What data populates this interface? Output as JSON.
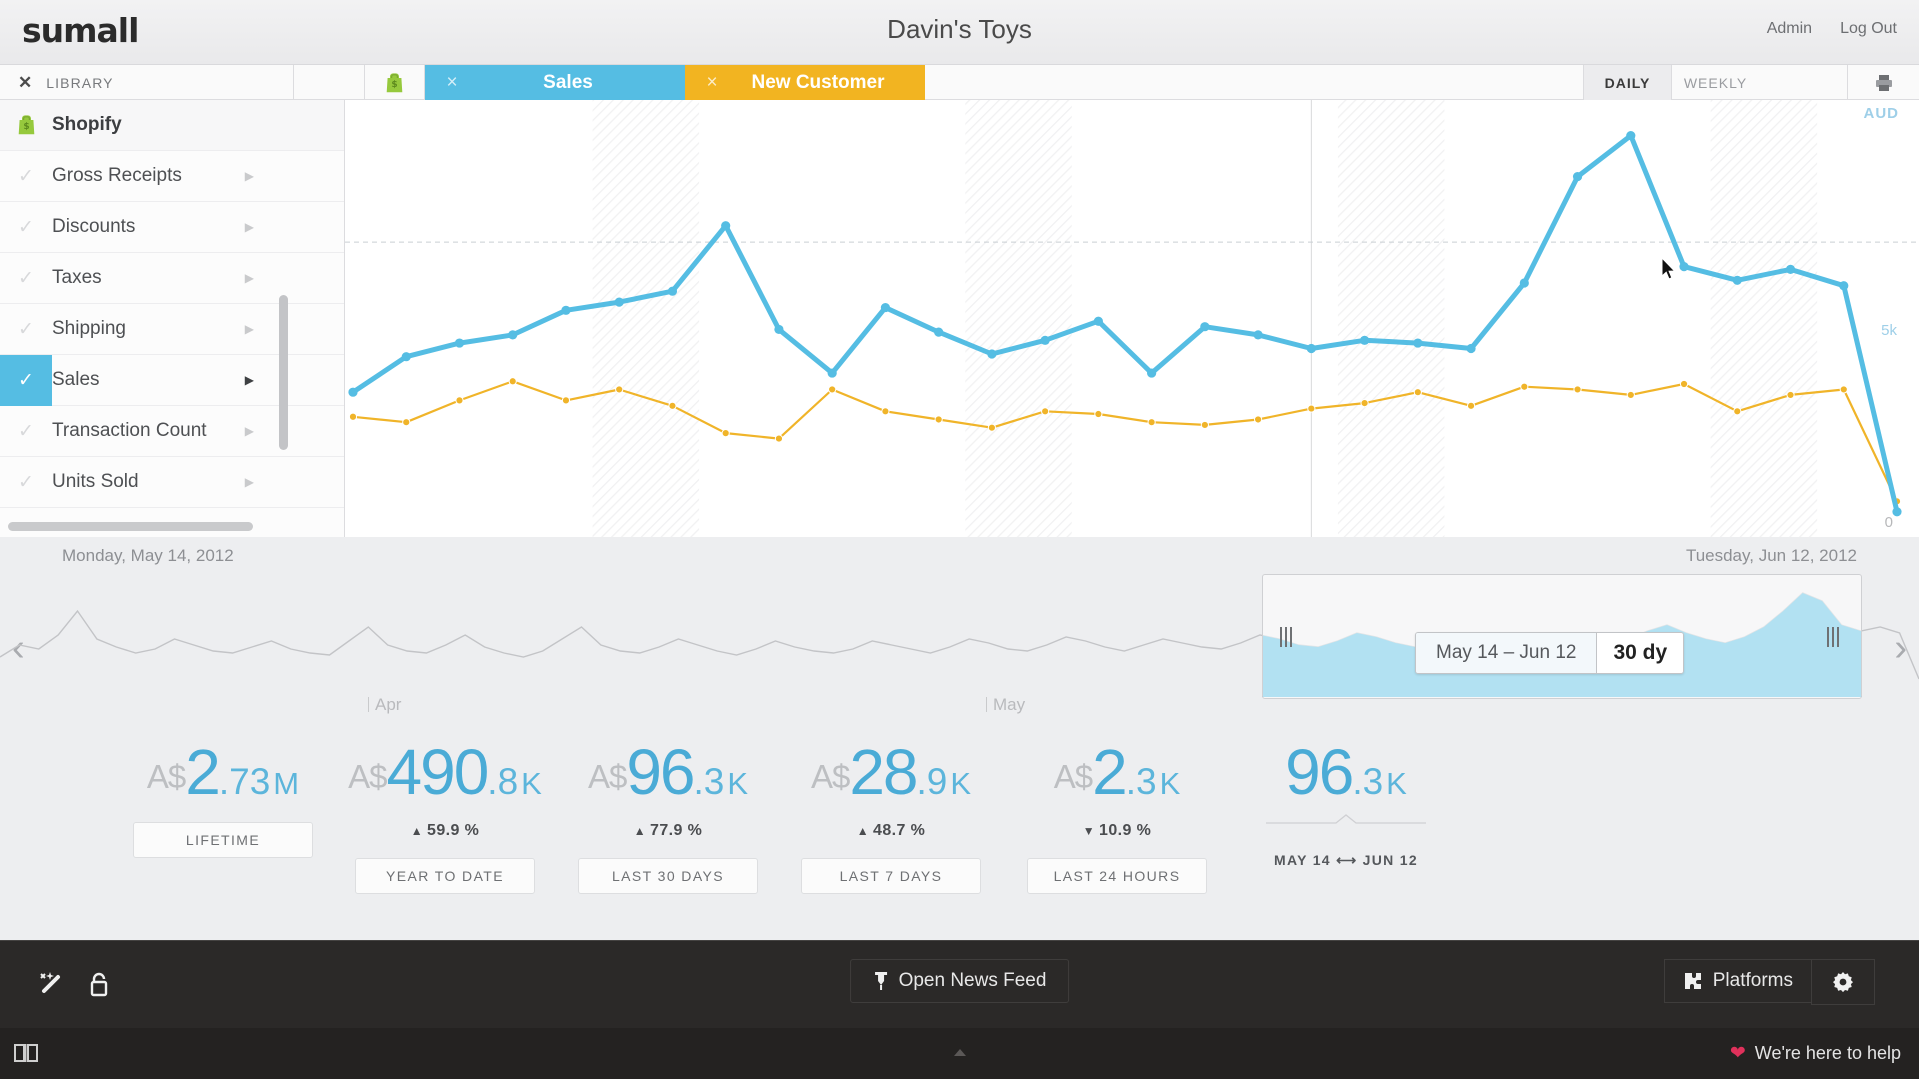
{
  "brand": {
    "logo": "sumall"
  },
  "header": {
    "title": "Davin's Toys",
    "nav": [
      {
        "label": "Admin"
      },
      {
        "label": "Log Out"
      }
    ]
  },
  "toolbar": {
    "library_label": "LIBRARY",
    "close_icon": "close-icon",
    "shopify_icon": "shopify-bag-icon",
    "tabs": [
      {
        "label": "Sales",
        "color": "#55bde3",
        "close": "×",
        "crown": true
      },
      {
        "label": "New Customer",
        "color": "#f2b421",
        "close": "×",
        "crown": false
      }
    ],
    "granularity": [
      {
        "label": "DAILY",
        "active": true
      },
      {
        "label": "WEEKLY",
        "active": false
      }
    ],
    "print_icon": "printer-icon"
  },
  "sidebar": {
    "source": {
      "label": "Shopify",
      "icon": "shopify-bag-icon"
    },
    "items": [
      {
        "label": "Gross Receipts",
        "selected": false
      },
      {
        "label": "Discounts",
        "selected": false
      },
      {
        "label": "Taxes",
        "selected": false
      },
      {
        "label": "Shipping",
        "selected": false
      },
      {
        "label": "Sales",
        "selected": true
      },
      {
        "label": "Transaction Count",
        "selected": false
      },
      {
        "label": "Units Sold",
        "selected": false
      }
    ]
  },
  "chart_axis": {
    "currency": "AUD",
    "y_top_label": "5k",
    "y_zero_label": "0",
    "date_start": "Monday, May 14, 2012",
    "date_end": "Tuesday, Jun 12, 2012"
  },
  "timeline": {
    "prev_icon": "chevron-left-icon",
    "next_icon": "chevron-right-icon",
    "months": [
      {
        "label": "Apr"
      },
      {
        "label": "May"
      }
    ],
    "range_dates": "May 14 – Jun 12",
    "range_duration": "30 dy",
    "left_grip": "drag-handle-icon",
    "right_grip": "drag-handle-icon"
  },
  "stats": [
    {
      "currency": "A$",
      "value": "2",
      "fraction": ".73",
      "unit": "M",
      "delta": null,
      "delta_dir": null,
      "button": "LIFETIME"
    },
    {
      "currency": "A$",
      "value": "490",
      "fraction": ".8",
      "unit": "K",
      "delta": "59.9 %",
      "delta_dir": "up",
      "button": "YEAR TO DATE"
    },
    {
      "currency": "A$",
      "value": "96",
      "fraction": ".3",
      "unit": "K",
      "delta": "77.9 %",
      "delta_dir": "up",
      "button": "LAST 30 DAYS"
    },
    {
      "currency": "A$",
      "value": "28",
      "fraction": ".9",
      "unit": "K",
      "delta": "48.7 %",
      "delta_dir": "up",
      "button": "LAST 7 DAYS"
    },
    {
      "currency": "A$",
      "value": "2",
      "fraction": ".3",
      "unit": "K",
      "delta": "10.9 %",
      "delta_dir": "down",
      "button": "LAST 24 HOURS"
    },
    {
      "currency": "",
      "value": "96",
      "fraction": ".3",
      "unit": "K",
      "delta": null,
      "delta_dir": null,
      "range_from": "MAY 14",
      "range_to": "JUN 12"
    }
  ],
  "footer": {
    "magic_icon": "magic-wand-icon",
    "lock_icon": "lock-icon",
    "news_feed": "Open News Feed",
    "news_icon": "rss-pin-icon",
    "platforms": "Platforms",
    "platforms_icon": "puzzle-icon",
    "gear_icon": "gear-icon",
    "book_icon": "book-icon",
    "help_text": "We're here to help",
    "heart_icon": "heart-icon"
  },
  "chart_data": {
    "type": "line",
    "title": "",
    "xlabel": "",
    "ylabel": "AUD",
    "ylim": [
      0,
      7200
    ],
    "grid": true,
    "legend_position": "none",
    "x": [
      "May 14",
      "May 15",
      "May 16",
      "May 17",
      "May 18",
      "May 19",
      "May 20",
      "May 21",
      "May 22",
      "May 23",
      "May 24",
      "May 25",
      "May 26",
      "May 27",
      "May 28",
      "May 29",
      "May 30",
      "May 31",
      "Jun 1",
      "Jun 2",
      "Jun 3",
      "Jun 4",
      "Jun 5",
      "Jun 6",
      "Jun 7",
      "Jun 8",
      "Jun 9",
      "Jun 10",
      "Jun 11",
      "Jun 12"
    ],
    "series": [
      {
        "name": "Sales",
        "color": "#55bde3",
        "values": [
          2250,
          2900,
          3150,
          3300,
          3750,
          3900,
          4100,
          5300,
          3400,
          2600,
          3800,
          3350,
          2950,
          3200,
          3550,
          2600,
          3450,
          3300,
          3050,
          3200,
          3150,
          3050,
          4250,
          6200,
          6950,
          4550,
          4300,
          4500,
          4200,
          60
        ]
      },
      {
        "name": "New Customer",
        "color": "#f0b429",
        "values": [
          1800,
          1700,
          2100,
          2450,
          2100,
          2300,
          2000,
          1500,
          1400,
          2300,
          1900,
          1750,
          1600,
          1900,
          1850,
          1700,
          1650,
          1750,
          1950,
          2050,
          2250,
          2000,
          2350,
          2300,
          2200,
          2400,
          1900,
          2200,
          2300,
          250
        ]
      }
    ]
  }
}
